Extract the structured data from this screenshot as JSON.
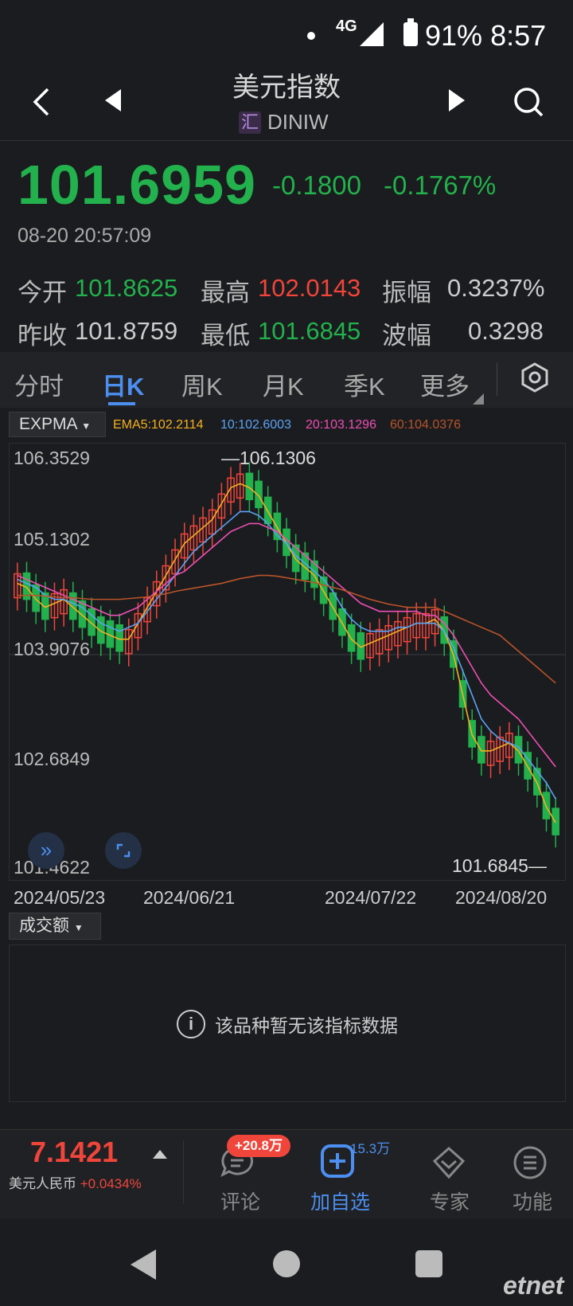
{
  "status_bar": {
    "network": "4G",
    "battery": "91%",
    "time": "8:57"
  },
  "header": {
    "title": "美元指数",
    "code_badge": "汇",
    "code": "DINIW"
  },
  "quote": {
    "price": "101.6959",
    "change": "-0.1800",
    "change_pct": "-0.1767%",
    "datetime": "08-20 20:57:09",
    "open_label": "今开",
    "open": "101.8625",
    "high_label": "最高",
    "high": "102.0143",
    "amp_label": "振幅",
    "amp": "0.3237%",
    "prev_label": "昨收",
    "prev": "101.8759",
    "low_label": "最低",
    "low": "101.6845",
    "wave_label": "波幅",
    "wave": "0.3298"
  },
  "tabs": [
    {
      "label": "分时"
    },
    {
      "label": "日K"
    },
    {
      "label": "周K"
    },
    {
      "label": "月K"
    },
    {
      "label": "季K"
    },
    {
      "label": "更多"
    }
  ],
  "indicator": {
    "selector": "EXPMA",
    "ema5": "EMA5:102.2114",
    "ema10": "10:102.6003",
    "ema20": "20:103.1296",
    "ema60": "60:104.0376"
  },
  "colors": {
    "up": "#f0453a",
    "down": "#22b14c",
    "accent": "#4c8ff0",
    "ema5": "#f5b021",
    "ema10": "#5aa3f5",
    "ema20": "#ee4fb5",
    "ema60": "#b9542a"
  },
  "chart_data": {
    "type": "candlestick",
    "y_ticks": [
      "106.3529",
      "105.1302",
      "103.9076",
      "102.6849",
      "101.4622"
    ],
    "ylim": [
      101.4622,
      106.3529
    ],
    "x_ticks": [
      "2024/05/23",
      "2024/06/21",
      "2024/07/22",
      "2024/08/20"
    ],
    "max_label": "106.1306",
    "min_label": "101.6845",
    "max_value": 106.1306,
    "min_value": 101.6845,
    "series": [
      {
        "name": "EMA5",
        "values": [
          104.8,
          104.75,
          104.6,
          104.5,
          104.55,
          104.6,
          104.5,
          104.4,
          104.3,
          104.2,
          104.15,
          104.1,
          104.1,
          104.3,
          104.5,
          104.7,
          104.9,
          105.1,
          105.3,
          105.4,
          105.5,
          105.6,
          105.8,
          106.0,
          106.05,
          106.0,
          105.9,
          105.7,
          105.5,
          105.3,
          105.1,
          105.0,
          104.9,
          104.7,
          104.5,
          104.3,
          104.1,
          104.0,
          104.05,
          104.1,
          104.15,
          104.2,
          104.25,
          104.3,
          104.3,
          104.35,
          104.2,
          103.9,
          103.4,
          102.9,
          102.7,
          102.7,
          102.75,
          102.8,
          102.7,
          102.5,
          102.3,
          102.0,
          101.8
        ]
      },
      {
        "name": "10",
        "values": [
          104.85,
          104.8,
          104.75,
          104.65,
          104.6,
          104.6,
          104.55,
          104.5,
          104.4,
          104.3,
          104.25,
          104.2,
          104.25,
          104.3,
          104.45,
          104.6,
          104.75,
          104.9,
          105.05,
          105.2,
          105.3,
          105.4,
          105.5,
          105.6,
          105.7,
          105.7,
          105.65,
          105.55,
          105.4,
          105.3,
          105.15,
          105.05,
          104.95,
          104.85,
          104.7,
          104.5,
          104.35,
          104.25,
          104.2,
          104.2,
          104.2,
          104.25,
          104.25,
          104.3,
          104.3,
          104.3,
          104.2,
          104.0,
          103.7,
          103.4,
          103.1,
          102.95,
          102.85,
          102.8,
          102.75,
          102.6,
          102.45,
          102.3,
          102.1
        ]
      },
      {
        "name": "20",
        "values": [
          104.9,
          104.85,
          104.8,
          104.75,
          104.7,
          104.65,
          104.6,
          104.55,
          104.5,
          104.45,
          104.4,
          104.4,
          104.45,
          104.5,
          104.6,
          104.7,
          104.8,
          104.9,
          104.95,
          105.05,
          105.15,
          105.25,
          105.35,
          105.45,
          105.5,
          105.55,
          105.55,
          105.5,
          105.45,
          105.35,
          105.25,
          105.15,
          105.05,
          104.95,
          104.85,
          104.75,
          104.65,
          104.55,
          104.5,
          104.45,
          104.45,
          104.45,
          104.45,
          104.45,
          104.4,
          104.4,
          104.3,
          104.15,
          103.95,
          103.75,
          103.55,
          103.4,
          103.3,
          103.2,
          103.1,
          102.95,
          102.8,
          102.65,
          102.5
        ]
      },
      {
        "name": "60",
        "values": [
          104.65,
          104.65,
          104.65,
          104.64,
          104.63,
          104.62,
          104.62,
          104.61,
          104.6,
          104.6,
          104.6,
          104.6,
          104.61,
          104.62,
          104.63,
          104.65,
          104.67,
          104.7,
          104.72,
          104.74,
          104.76,
          104.78,
          104.8,
          104.83,
          104.86,
          104.88,
          104.9,
          104.9,
          104.89,
          104.87,
          104.85,
          104.83,
          104.81,
          104.78,
          104.75,
          104.72,
          104.68,
          104.64,
          104.6,
          104.57,
          104.54,
          104.52,
          104.5,
          104.5,
          104.5,
          104.5,
          104.45,
          104.4,
          104.35,
          104.3,
          104.25,
          104.2,
          104.15,
          104.05,
          103.95,
          103.85,
          103.75,
          103.65,
          103.55
        ]
      }
    ]
  },
  "volume": {
    "selector": "成交额",
    "no_data": "该品种暂无该指标数据"
  },
  "bottom": {
    "cny_price": "7.1421",
    "cny_label": "美元人民币",
    "cny_change": "+0.0434%",
    "comment_badge": "+20.8万",
    "comment_label": "评论",
    "fav_count": "15.3万",
    "fav_label": "加自选",
    "expert_label": "专家",
    "func_label": "功能"
  },
  "watermark": "etnet"
}
